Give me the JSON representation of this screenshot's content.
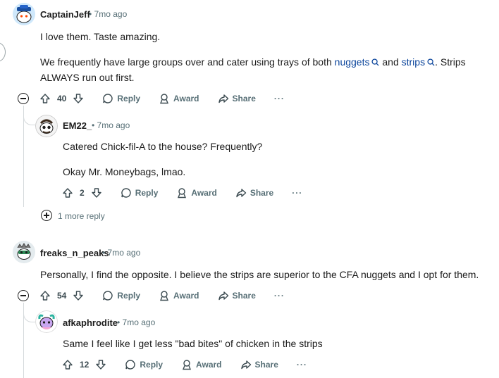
{
  "comments": [
    {
      "username": "CaptainJeff",
      "time": "7mo ago",
      "line1": "I love them. Taste amazing.",
      "line2_pre": "We frequently have large groups over and cater using trays of both ",
      "link1": "nuggets",
      "mid": " and ",
      "link2": "strips",
      "line2_post": ". Strips",
      "line3": "ALWAYS run out first.",
      "votes": "40",
      "reply_label": "Reply",
      "award_label": "Award",
      "share_label": "Share"
    },
    {
      "username": "EM22_",
      "time": "7mo ago",
      "line1": "Catered Chick-fil-A to the house? Frequently?",
      "line2": "Okay Mr. Moneybags, lmao.",
      "votes": "2",
      "reply_label": "Reply",
      "award_label": "Award",
      "share_label": "Share"
    },
    {
      "username": "freaks_n_peaks",
      "time": "7mo ago",
      "line1": "Personally, I find the opposite. I believe the strips are superior to the CFA nuggets and I opt for them.",
      "votes": "54",
      "reply_label": "Reply",
      "award_label": "Award",
      "share_label": "Share"
    },
    {
      "username": "afkaphrodite",
      "time": "7mo ago",
      "line1": "Same I feel like I get less \"bad bites\" of chicken in the strips",
      "votes": "12",
      "reply_label": "Reply",
      "award_label": "Award",
      "share_label": "Share"
    }
  ],
  "more_replies": "1 more reply",
  "separator": "•",
  "overflow": "···",
  "colors": {
    "text": "#1c1c1c",
    "meta": "#576f76",
    "link": "#0a449b",
    "line": "#d5dadc"
  }
}
